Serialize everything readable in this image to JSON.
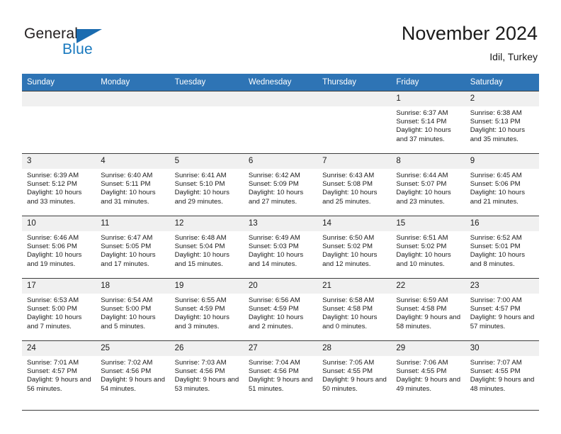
{
  "brand": {
    "name_part1": "General",
    "name_part2": "Blue",
    "logo_icon": "triangle-mark",
    "color_dark": "#231f20",
    "color_blue": "#1878be"
  },
  "header": {
    "title": "November 2024",
    "location": "Idil, Turkey"
  },
  "theme": {
    "header_row_bg": "#2e74b5",
    "daynum_bg": "#f0f0f0",
    "grid_line": "#3e3e3e",
    "text": "#1a1a1a"
  },
  "weekdays": [
    "Sunday",
    "Monday",
    "Tuesday",
    "Wednesday",
    "Thursday",
    "Friday",
    "Saturday"
  ],
  "weeks": [
    [
      {
        "day": "",
        "empty": true
      },
      {
        "day": "",
        "empty": true
      },
      {
        "day": "",
        "empty": true
      },
      {
        "day": "",
        "empty": true
      },
      {
        "day": "",
        "empty": true
      },
      {
        "day": "1",
        "sunrise": "Sunrise: 6:37 AM",
        "sunset": "Sunset: 5:14 PM",
        "daylight": "Daylight: 10 hours and 37 minutes."
      },
      {
        "day": "2",
        "sunrise": "Sunrise: 6:38 AM",
        "sunset": "Sunset: 5:13 PM",
        "daylight": "Daylight: 10 hours and 35 minutes."
      }
    ],
    [
      {
        "day": "3",
        "sunrise": "Sunrise: 6:39 AM",
        "sunset": "Sunset: 5:12 PM",
        "daylight": "Daylight: 10 hours and 33 minutes."
      },
      {
        "day": "4",
        "sunrise": "Sunrise: 6:40 AM",
        "sunset": "Sunset: 5:11 PM",
        "daylight": "Daylight: 10 hours and 31 minutes."
      },
      {
        "day": "5",
        "sunrise": "Sunrise: 6:41 AM",
        "sunset": "Sunset: 5:10 PM",
        "daylight": "Daylight: 10 hours and 29 minutes."
      },
      {
        "day": "6",
        "sunrise": "Sunrise: 6:42 AM",
        "sunset": "Sunset: 5:09 PM",
        "daylight": "Daylight: 10 hours and 27 minutes."
      },
      {
        "day": "7",
        "sunrise": "Sunrise: 6:43 AM",
        "sunset": "Sunset: 5:08 PM",
        "daylight": "Daylight: 10 hours and 25 minutes."
      },
      {
        "day": "8",
        "sunrise": "Sunrise: 6:44 AM",
        "sunset": "Sunset: 5:07 PM",
        "daylight": "Daylight: 10 hours and 23 minutes."
      },
      {
        "day": "9",
        "sunrise": "Sunrise: 6:45 AM",
        "sunset": "Sunset: 5:06 PM",
        "daylight": "Daylight: 10 hours and 21 minutes."
      }
    ],
    [
      {
        "day": "10",
        "sunrise": "Sunrise: 6:46 AM",
        "sunset": "Sunset: 5:06 PM",
        "daylight": "Daylight: 10 hours and 19 minutes."
      },
      {
        "day": "11",
        "sunrise": "Sunrise: 6:47 AM",
        "sunset": "Sunset: 5:05 PM",
        "daylight": "Daylight: 10 hours and 17 minutes."
      },
      {
        "day": "12",
        "sunrise": "Sunrise: 6:48 AM",
        "sunset": "Sunset: 5:04 PM",
        "daylight": "Daylight: 10 hours and 15 minutes."
      },
      {
        "day": "13",
        "sunrise": "Sunrise: 6:49 AM",
        "sunset": "Sunset: 5:03 PM",
        "daylight": "Daylight: 10 hours and 14 minutes."
      },
      {
        "day": "14",
        "sunrise": "Sunrise: 6:50 AM",
        "sunset": "Sunset: 5:02 PM",
        "daylight": "Daylight: 10 hours and 12 minutes."
      },
      {
        "day": "15",
        "sunrise": "Sunrise: 6:51 AM",
        "sunset": "Sunset: 5:02 PM",
        "daylight": "Daylight: 10 hours and 10 minutes."
      },
      {
        "day": "16",
        "sunrise": "Sunrise: 6:52 AM",
        "sunset": "Sunset: 5:01 PM",
        "daylight": "Daylight: 10 hours and 8 minutes."
      }
    ],
    [
      {
        "day": "17",
        "sunrise": "Sunrise: 6:53 AM",
        "sunset": "Sunset: 5:00 PM",
        "daylight": "Daylight: 10 hours and 7 minutes."
      },
      {
        "day": "18",
        "sunrise": "Sunrise: 6:54 AM",
        "sunset": "Sunset: 5:00 PM",
        "daylight": "Daylight: 10 hours and 5 minutes."
      },
      {
        "day": "19",
        "sunrise": "Sunrise: 6:55 AM",
        "sunset": "Sunset: 4:59 PM",
        "daylight": "Daylight: 10 hours and 3 minutes."
      },
      {
        "day": "20",
        "sunrise": "Sunrise: 6:56 AM",
        "sunset": "Sunset: 4:59 PM",
        "daylight": "Daylight: 10 hours and 2 minutes."
      },
      {
        "day": "21",
        "sunrise": "Sunrise: 6:58 AM",
        "sunset": "Sunset: 4:58 PM",
        "daylight": "Daylight: 10 hours and 0 minutes."
      },
      {
        "day": "22",
        "sunrise": "Sunrise: 6:59 AM",
        "sunset": "Sunset: 4:58 PM",
        "daylight": "Daylight: 9 hours and 58 minutes."
      },
      {
        "day": "23",
        "sunrise": "Sunrise: 7:00 AM",
        "sunset": "Sunset: 4:57 PM",
        "daylight": "Daylight: 9 hours and 57 minutes."
      }
    ],
    [
      {
        "day": "24",
        "sunrise": "Sunrise: 7:01 AM",
        "sunset": "Sunset: 4:57 PM",
        "daylight": "Daylight: 9 hours and 56 minutes."
      },
      {
        "day": "25",
        "sunrise": "Sunrise: 7:02 AM",
        "sunset": "Sunset: 4:56 PM",
        "daylight": "Daylight: 9 hours and 54 minutes."
      },
      {
        "day": "26",
        "sunrise": "Sunrise: 7:03 AM",
        "sunset": "Sunset: 4:56 PM",
        "daylight": "Daylight: 9 hours and 53 minutes."
      },
      {
        "day": "27",
        "sunrise": "Sunrise: 7:04 AM",
        "sunset": "Sunset: 4:56 PM",
        "daylight": "Daylight: 9 hours and 51 minutes."
      },
      {
        "day": "28",
        "sunrise": "Sunrise: 7:05 AM",
        "sunset": "Sunset: 4:55 PM",
        "daylight": "Daylight: 9 hours and 50 minutes."
      },
      {
        "day": "29",
        "sunrise": "Sunrise: 7:06 AM",
        "sunset": "Sunset: 4:55 PM",
        "daylight": "Daylight: 9 hours and 49 minutes."
      },
      {
        "day": "30",
        "sunrise": "Sunrise: 7:07 AM",
        "sunset": "Sunset: 4:55 PM",
        "daylight": "Daylight: 9 hours and 48 minutes."
      }
    ]
  ]
}
